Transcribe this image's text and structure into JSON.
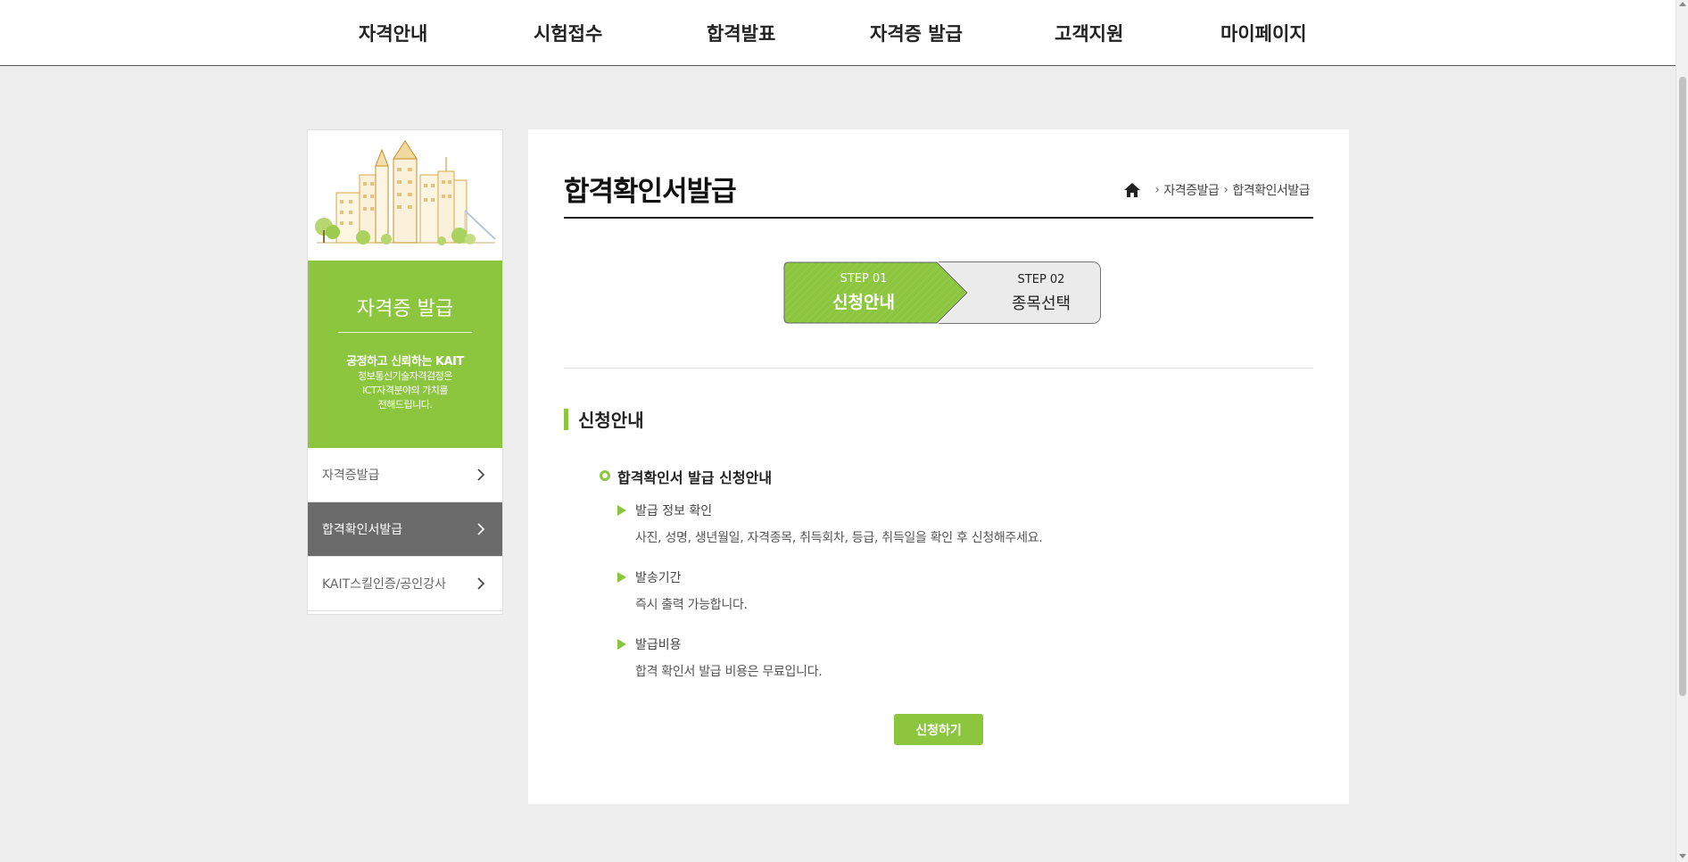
{
  "nav": {
    "items": [
      "자격안내",
      "시험접수",
      "합격발표",
      "자격증 발급",
      "고객지원",
      "마이페이지"
    ]
  },
  "sidebar": {
    "title": "자격증 발급",
    "slogan": "공정하고 신뢰하는 KAIT",
    "desc_lines": [
      "정보통신기술자격검정은",
      "ICT자격분야의 가치를",
      "전해드립니다."
    ],
    "items": [
      {
        "label": "자격증발급",
        "active": false
      },
      {
        "label": "합격확인서발급",
        "active": true
      },
      {
        "label": "KAIT스킬인증/공인강사",
        "active": false
      }
    ]
  },
  "main": {
    "title": "합격확인서발급",
    "breadcrumb": [
      "자격증발급",
      "합격확인서발급"
    ],
    "steps": [
      {
        "step": "STEP 01",
        "label": "신청안내",
        "active": true
      },
      {
        "step": "STEP 02",
        "label": "종목선택",
        "active": false
      }
    ],
    "section_title": "신청안내",
    "sub_title": "합격확인서 발급 신청안내",
    "items": [
      {
        "title": "발급 정보 확인",
        "desc": "사진, 성명, 생년월일, 자격종목, 취득회차, 등급, 취득일을 확인 후 신청해주세요."
      },
      {
        "title": "발송기간",
        "desc": "즉시 출력 가능합니다."
      },
      {
        "title": "발급비용",
        "desc": "합격 확인서 발급 비용은 무료입니다."
      }
    ],
    "apply_label": "신청하기"
  },
  "colors": {
    "accent": "#8cc63f",
    "active_menu": "#6b6b6b",
    "page_bg": "#eeeeee"
  }
}
